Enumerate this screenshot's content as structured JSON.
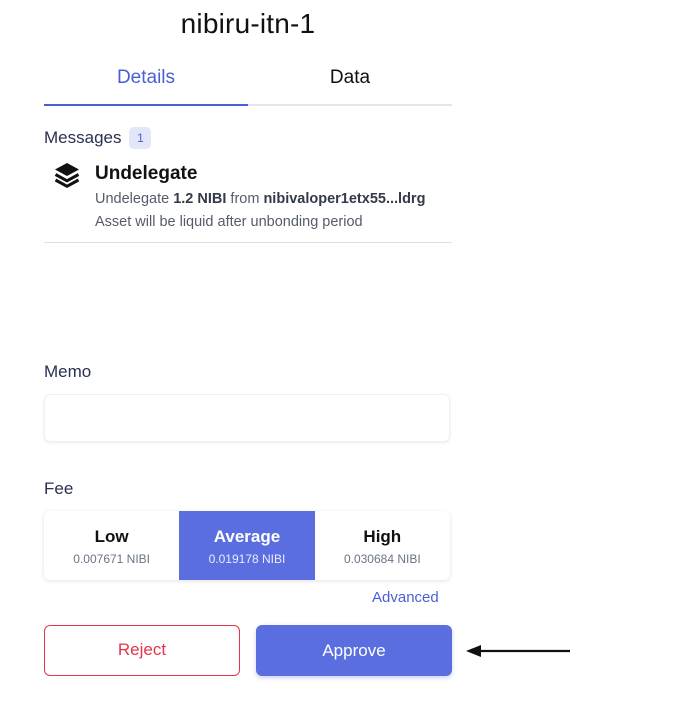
{
  "chain": {
    "title": "nibiru-itn-1"
  },
  "tabs": [
    {
      "label": "Details",
      "active": true
    },
    {
      "label": "Data",
      "active": false
    }
  ],
  "messages": {
    "label": "Messages",
    "count": "1",
    "items": [
      {
        "icon": "layers-icon",
        "title": "Undelegate",
        "line1_prefix": "Undelegate ",
        "amount": "1.2 NIBI",
        "line1_mid": " from ",
        "validator": "nibivaloper1etx55...ldrg",
        "line2": "Asset will be liquid after unbonding period"
      }
    ]
  },
  "memo": {
    "label": "Memo",
    "value": "",
    "placeholder": ""
  },
  "fee": {
    "label": "Fee",
    "options": [
      {
        "name": "Low",
        "amount": "0.007671 NIBI",
        "selected": false
      },
      {
        "name": "Average",
        "amount": "0.019178 NIBI",
        "selected": true
      },
      {
        "name": "High",
        "amount": "0.030684 NIBI",
        "selected": false
      }
    ],
    "advanced_label": "Advanced"
  },
  "actions": {
    "reject_label": "Reject",
    "approve_label": "Approve"
  },
  "colors": {
    "accent": "#5b6ee0",
    "link": "#4a5fd6",
    "danger": "#e6344a"
  }
}
